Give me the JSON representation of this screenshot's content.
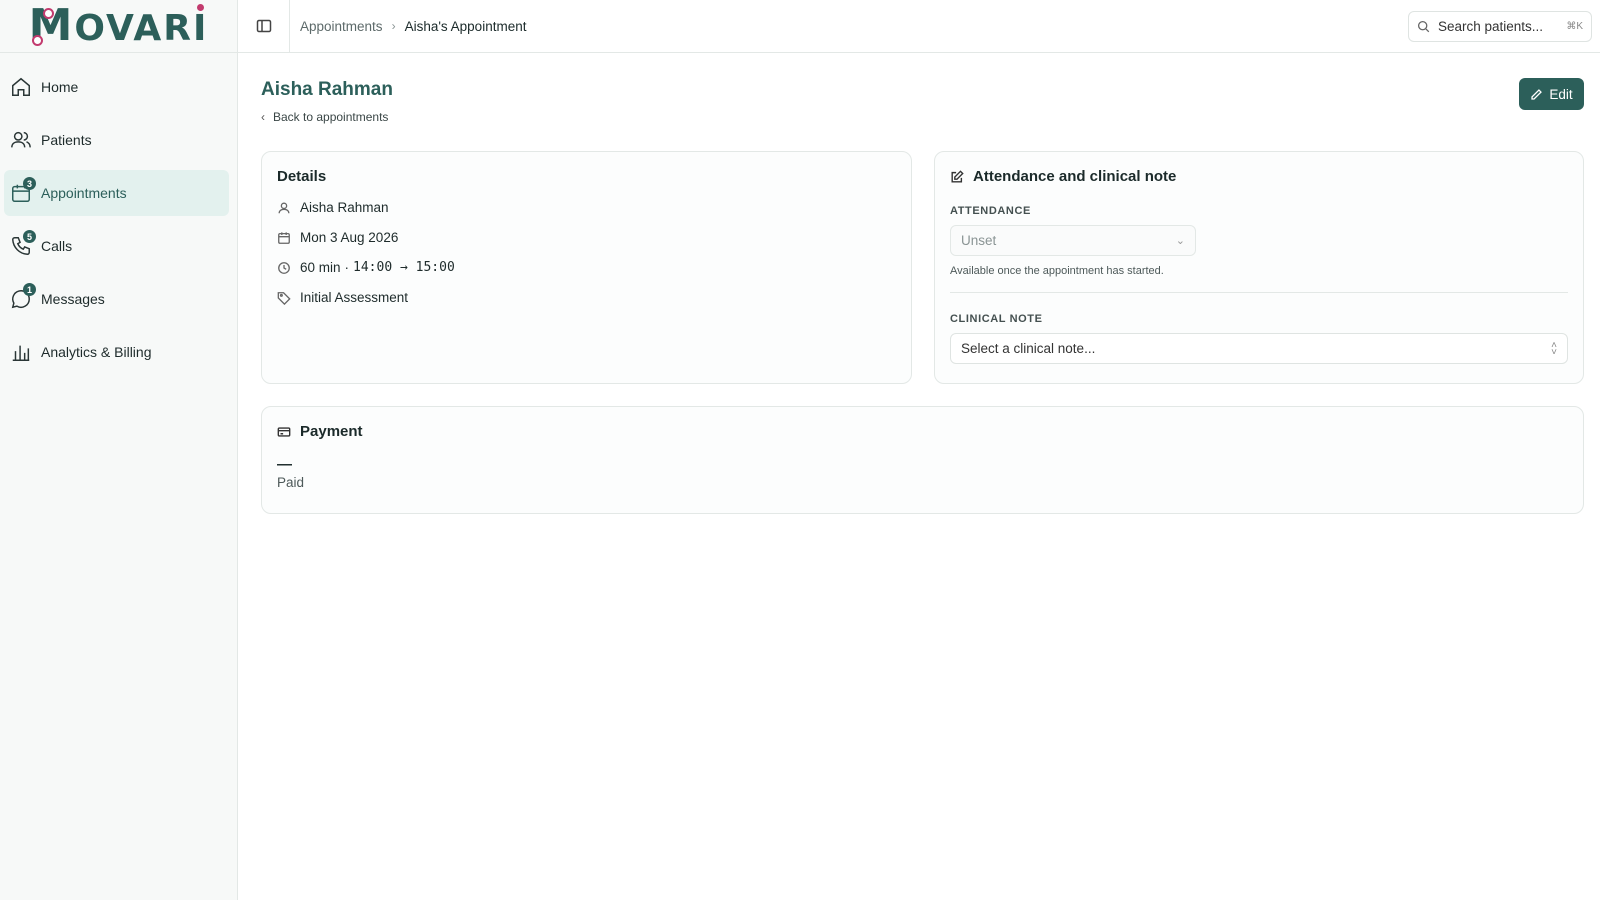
{
  "app": {
    "logo_text": "MOVARI"
  },
  "sidebar": {
    "items": [
      {
        "label": "Home",
        "icon": "home-icon",
        "badge": null,
        "active": false
      },
      {
        "label": "Patients",
        "icon": "users-icon",
        "badge": null,
        "active": false
      },
      {
        "label": "Appointments",
        "icon": "calendar-icon",
        "badge": "3",
        "active": true
      },
      {
        "label": "Calls",
        "icon": "phone-icon",
        "badge": "5",
        "active": false
      },
      {
        "label": "Messages",
        "icon": "message-icon",
        "badge": "1",
        "active": false
      },
      {
        "label": "Analytics & Billing",
        "icon": "bar-chart-icon",
        "badge": null,
        "active": false
      }
    ]
  },
  "topbar": {
    "breadcrumb": [
      "Appointments",
      "Aisha's Appointment"
    ],
    "search_placeholder": "Search patients...",
    "search_shortcut": "⌘K"
  },
  "page": {
    "title": "Aisha Rahman",
    "back_label": "Back to appointments",
    "edit_label": "Edit"
  },
  "details": {
    "title": "Details",
    "patient": "Aisha Rahman",
    "date": "Mon 3 Aug 2026",
    "duration": "60 min",
    "separator": "·",
    "time_range": "14:00 → 15:00",
    "type": "Initial Assessment"
  },
  "attendance": {
    "title": "Attendance and clinical note",
    "attendance_label": "ATTENDANCE",
    "attendance_value": "Unset",
    "attendance_helper": "Available once the appointment has started.",
    "note_label": "CLINICAL NOTE",
    "note_placeholder": "Select a clinical note..."
  },
  "payment": {
    "title": "Payment",
    "amount": "—",
    "status": "Paid"
  },
  "colors": {
    "brand": "#2c5f5a",
    "accent_dot": "#c23b6e",
    "active_bg": "#e3f1ee"
  }
}
